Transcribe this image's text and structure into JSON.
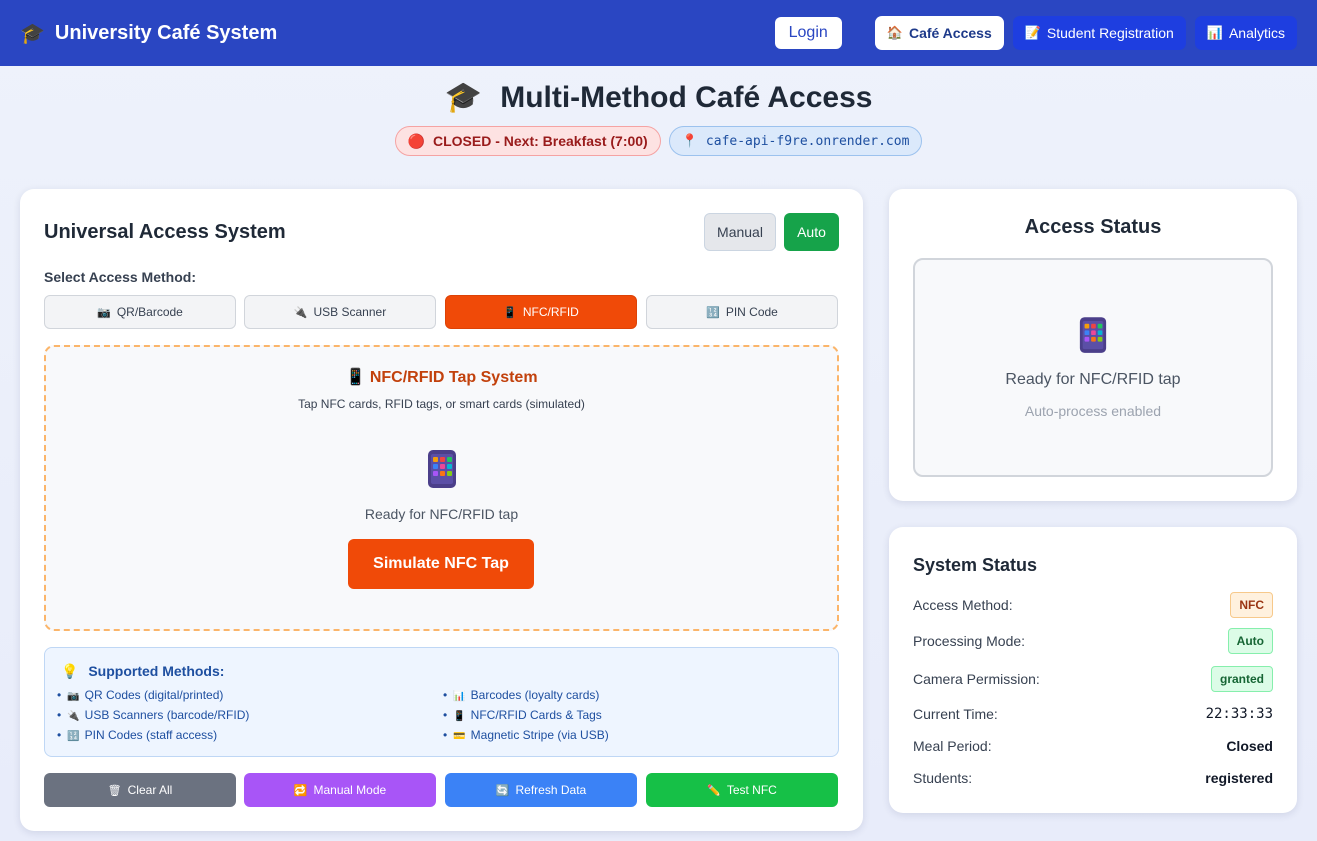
{
  "header": {
    "brand": "University Café System",
    "login_label": "Login",
    "tabs": [
      {
        "label": "Café Access",
        "icon": "🏠",
        "active": true
      },
      {
        "label": "Student Registration",
        "icon": "📝",
        "active": false
      },
      {
        "label": "Analytics",
        "icon": "📊",
        "active": false
      }
    ]
  },
  "page": {
    "title": "Multi-Method Café Access",
    "status_pill": "CLOSED - Next: Breakfast (7:00)",
    "api_pill": "cafe-api-f9re.onrender.com"
  },
  "main": {
    "title": "Universal Access System",
    "mode_manual": "Manual",
    "mode_auto": "Auto",
    "select_label": "Select Access Method:",
    "methods": [
      {
        "label": "QR/Barcode",
        "icon": "📷"
      },
      {
        "label": "USB Scanner",
        "icon": "🔌"
      },
      {
        "label": "NFC/RFID",
        "icon": "📱"
      },
      {
        "label": "PIN Code",
        "icon": "🔢"
      }
    ],
    "nfc": {
      "title": "NFC/RFID Tap System",
      "subtitle": "Tap NFC cards, RFID tags, or smart cards (simulated)",
      "ready": "Ready for NFC/RFID tap",
      "simulate": "Simulate NFC Tap"
    },
    "supported": {
      "title": "Supported Methods:",
      "items": [
        {
          "icon": "📷",
          "label": "QR Codes (digital/printed)"
        },
        {
          "icon": "📊",
          "label": "Barcodes (loyalty cards)"
        },
        {
          "icon": "🔌",
          "label": "USB Scanners (barcode/RFID)"
        },
        {
          "icon": "📱",
          "label": "NFC/RFID Cards & Tags"
        },
        {
          "icon": "🔢",
          "label": "PIN Codes (staff access)"
        },
        {
          "icon": "💳",
          "label": "Magnetic Stripe (via USB)"
        }
      ]
    },
    "actions": {
      "clear": "Clear All",
      "manual": "Manual Mode",
      "refresh": "Refresh Data",
      "test": "Test NFC"
    }
  },
  "access_status": {
    "title": "Access Status",
    "ready": "Ready for NFC/RFID tap",
    "auto": "Auto-process enabled"
  },
  "system_status": {
    "title": "System Status",
    "rows": [
      {
        "label": "Access Method:",
        "value": "NFC"
      },
      {
        "label": "Processing Mode:",
        "value": "Auto"
      },
      {
        "label": "Camera Permission:",
        "value": "granted"
      },
      {
        "label": "Current Time:",
        "value": "22:33:33"
      },
      {
        "label": "Meal Period:",
        "value": "Closed"
      },
      {
        "label": "Students:",
        "value": "registered"
      }
    ]
  },
  "colors": {
    "header": "#2a46c2",
    "accent_orange": "#f04a08",
    "auto_green": "#16a34a",
    "closed_red": "#991b1b"
  }
}
